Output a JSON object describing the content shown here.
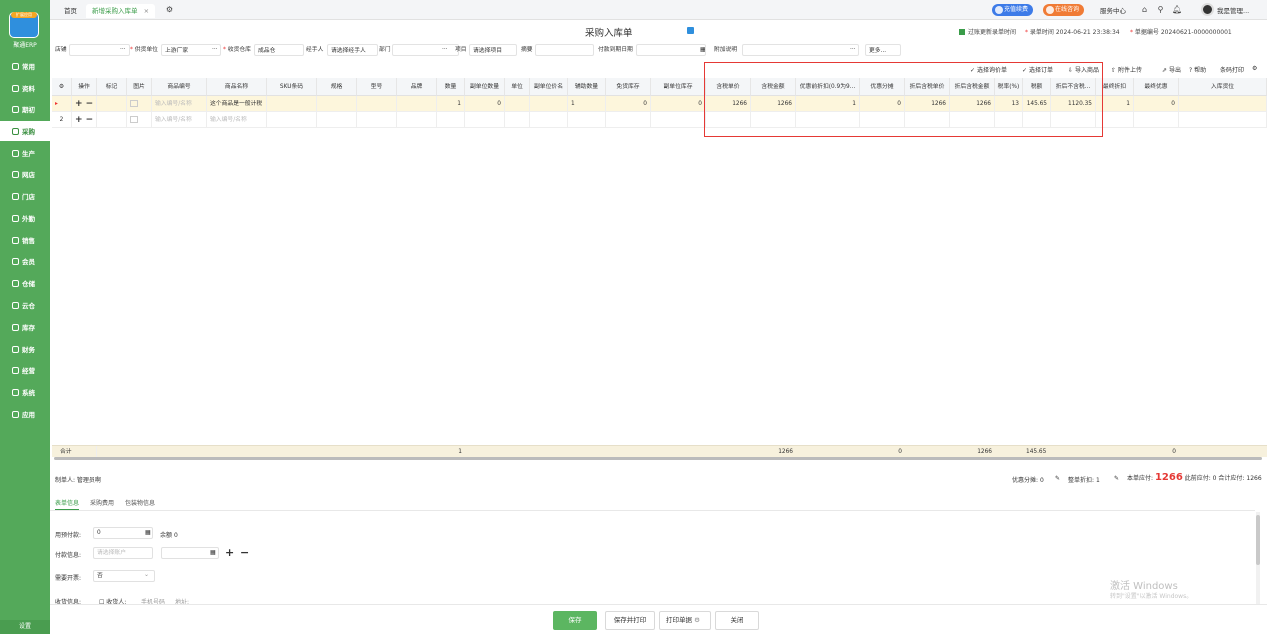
{
  "sidebar": {
    "badge": "扩展应用",
    "brand": "聚通ERP",
    "settings": "设置",
    "items": [
      {
        "label": "常用"
      },
      {
        "label": "资料"
      },
      {
        "label": "期初"
      },
      {
        "label": "采购"
      },
      {
        "label": "生产"
      },
      {
        "label": "网店"
      },
      {
        "label": "门店"
      },
      {
        "label": "外勤"
      },
      {
        "label": "销售"
      },
      {
        "label": "会员"
      },
      {
        "label": "仓储"
      },
      {
        "label": "云仓"
      },
      {
        "label": "库存"
      },
      {
        "label": "财务"
      },
      {
        "label": "经营"
      },
      {
        "label": "系统"
      },
      {
        "label": "应用"
      }
    ]
  },
  "topbar": {
    "tab_home": "首页",
    "tab_active": "新增采购入库单",
    "close": "×",
    "recharge": "充值续费",
    "consult": "在线咨询",
    "service": "服务中心",
    "user": "我是管理..."
  },
  "header": {
    "title": "采购入库单",
    "refresh_time_label": "过账更新录单时间",
    "entry_time_label": "录单时间",
    "entry_time": "2024-06-21 23:38:34",
    "doc_no_label": "单据编号",
    "doc_no": "20240621-0000000001"
  },
  "fields": {
    "shop": {
      "label": "店铺",
      "value": "",
      "ellipsis": "···"
    },
    "supplier": {
      "label": "供货单位",
      "value": "上游厂家",
      "ellipsis": "···"
    },
    "warehouse": {
      "label": "收货仓库",
      "value": "成品仓"
    },
    "handler": {
      "label": "经手人",
      "placeholder": "请选择经手人"
    },
    "dept": {
      "label": "部门",
      "value": "",
      "ellipsis": "···"
    },
    "project": {
      "label": "项目",
      "placeholder": "请选择项目"
    },
    "summary": {
      "label": "摘要",
      "value": ""
    },
    "due_date": {
      "label": "付款到期日期",
      "value": ""
    },
    "attachment": {
      "label": "附加说明",
      "value": "",
      "ellipsis": "···"
    },
    "more": "更多..."
  },
  "toolbar": {
    "select_price": "选择询价单",
    "select_order": "选择订单",
    "import": "导入商品",
    "attach": "附件上传",
    "export": "导出",
    "help": "帮助",
    "barcode_print": "条码打印"
  },
  "columns": [
    "操作",
    "标记",
    "图片",
    "商品编号",
    "商品名称",
    "SKU条码",
    "规格",
    "型号",
    "品牌",
    "数量",
    "副单位数量",
    "单位",
    "副单位价名",
    "辅助数量",
    "免货库存",
    "副单位库存",
    "含税单价",
    "含税金额",
    "优惠前折扣(0.9为9...",
    "优惠分摊",
    "折后含税单价",
    "折后含税金额",
    "税率(%)",
    "税额",
    "折后不含税...",
    "最终折扣",
    "最终优惠",
    "入库货位"
  ],
  "rows": [
    {
      "no": "1",
      "code_ph": "输入编号/名称",
      "name": "这个商品是一般计税",
      "qty": "1",
      "sub_qty": "0",
      "aux_qty": "1",
      "stock": "0",
      "sub_stock": "0",
      "price": "1266",
      "amount": "1266",
      "discount": "1",
      "share": "0",
      "disc_price": "1266",
      "disc_amount": "1266",
      "tax_rate": "13",
      "tax": "145.65",
      "notax": "1120.35",
      "final_disc": "1",
      "final_pref": "0"
    },
    {
      "no": "2",
      "code_ph": "输入编号/名称",
      "name_ph": "输入编号/名称"
    }
  ],
  "totals": {
    "label": "合计",
    "qty": "1",
    "amount": "1266",
    "share": "0",
    "disc_amount": "1266",
    "tax": "145.65",
    "final_pref": "0"
  },
  "footer": {
    "creator": "制单人: 管理员啊",
    "pref_share_label": "优惠分摊:",
    "pref_share": "0",
    "whole_disc_label": "整单折扣:",
    "whole_disc": "1",
    "payable_label": "本单应付:",
    "payable": "1266",
    "paid_label": "此前应付:",
    "paid": "0",
    "total_label": "合计应付:",
    "total": "1266"
  },
  "bottom_tabs": [
    "表单信息",
    "采购费用",
    "包装物信息"
  ],
  "form": {
    "prepay_label": "用预付款:",
    "prepay": "0",
    "balance_label": "余额",
    "balance": "0",
    "pay_label": "付款信息:",
    "pay_placeholder": "请选择账户",
    "invoice_label": "需要开票:",
    "invoice": "否",
    "receiver_label": "收货信息:",
    "receiver_name": "收货人:",
    "receiver_phone": "手机号码",
    "receiver_addr": "地址:"
  },
  "watermark": {
    "line1": "激活 Windows",
    "line2": "转到\"设置\"以激活 Windows。"
  },
  "actions": {
    "save": "保存",
    "save_print": "保存并打印",
    "print": "打印单据",
    "close": "关闭"
  },
  "colors": {
    "brand_green": "#54a95a",
    "accent_green": "#3a9c49",
    "highlight_red": "#e53935",
    "payable_red": "#e53935"
  }
}
